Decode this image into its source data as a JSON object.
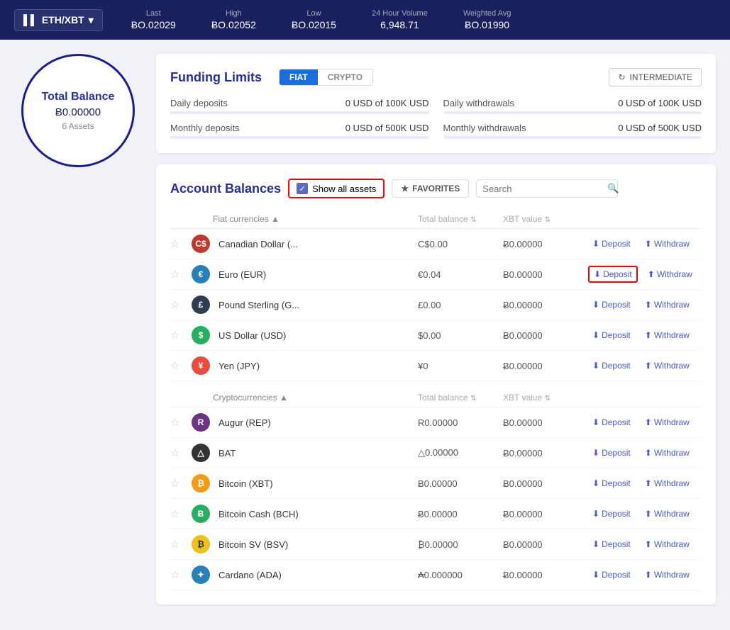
{
  "topbar": {
    "ticker": "ETH/XBT",
    "stats": [
      {
        "label": "Last",
        "value": "ɃO.02029"
      },
      {
        "label": "High",
        "value": "ɃO.02052"
      },
      {
        "label": "Low",
        "value": "ɃO.02015"
      },
      {
        "label": "24 Hour Volume",
        "value": "6,948.71"
      },
      {
        "label": "Weighted Avg",
        "value": "ɃO.01990"
      }
    ]
  },
  "balance": {
    "title": "Total Balance",
    "amount": "Ƀ0.00000",
    "assets": "6 Assets"
  },
  "funding": {
    "title": "Funding Limits",
    "tab_fiat": "FIAT",
    "tab_crypto": "CRYPTO",
    "level_btn": "INTERMEDIATE",
    "rows": [
      {
        "label": "Daily deposits",
        "value": "0 USD of 100K USD"
      },
      {
        "label": "Daily withdrawals",
        "value": "0 USD of 100K USD"
      },
      {
        "label": "Monthly deposits",
        "value": "0 USD of 500K USD"
      },
      {
        "label": "Monthly withdrawals",
        "value": "0 USD of 500K USD"
      }
    ]
  },
  "balances": {
    "title": "Account Balances",
    "show_all_label": "Show all assets",
    "favorites_label": "FAVORITES",
    "search_placeholder": "Search",
    "fiat_section": "Fiat currencies ▲",
    "crypto_section": "Cryptocurrencies ▲",
    "col_total": "Total balance",
    "col_xbt": "XBT value",
    "fiat_assets": [
      {
        "name": "Canadian Dollar (...",
        "icon_class": "icon-cad",
        "icon_text": "C$",
        "total": "C$0.00",
        "xbt": "Ƀ0.00000",
        "deposit_highlighted": false
      },
      {
        "name": "Euro (EUR)",
        "icon_class": "icon-eur",
        "icon_text": "€",
        "total": "€0.04",
        "xbt": "Ƀ0.00000",
        "deposit_highlighted": true
      },
      {
        "name": "Pound Sterling (G...",
        "icon_class": "icon-gbp",
        "icon_text": "£",
        "total": "£0.00",
        "xbt": "Ƀ0.00000",
        "deposit_highlighted": false
      },
      {
        "name": "US Dollar (USD)",
        "icon_class": "icon-usd",
        "icon_text": "$",
        "total": "$0.00",
        "xbt": "Ƀ0.00000",
        "deposit_highlighted": false
      },
      {
        "name": "Yen (JPY)",
        "icon_class": "icon-jpy",
        "icon_text": "¥",
        "total": "¥0",
        "xbt": "Ƀ0.00000",
        "deposit_highlighted": false
      }
    ],
    "crypto_assets": [
      {
        "name": "Augur (REP)",
        "icon_class": "icon-rep",
        "icon_text": "R",
        "total": "R0.00000",
        "xbt": "Ƀ0.00000",
        "deposit_highlighted": false
      },
      {
        "name": "BAT",
        "icon_class": "icon-bat",
        "icon_text": "△",
        "total": "△0.00000",
        "xbt": "Ƀ0.00000",
        "deposit_highlighted": false
      },
      {
        "name": "Bitcoin (XBT)",
        "icon_class": "icon-btc",
        "icon_text": "₿",
        "total": "Ƀ0.00000",
        "xbt": "Ƀ0.00000",
        "deposit_highlighted": false
      },
      {
        "name": "Bitcoin Cash (BCH)",
        "icon_class": "icon-bch",
        "icon_text": "Ƀ",
        "total": "Ƀ0.00000",
        "xbt": "Ƀ0.00000",
        "deposit_highlighted": false
      },
      {
        "name": "Bitcoin SV (BSV)",
        "icon_class": "icon-bsv",
        "icon_text": "₿",
        "total": "₿0.00000",
        "xbt": "Ƀ0.00000",
        "deposit_highlighted": false
      },
      {
        "name": "Cardano (ADA)",
        "icon_class": "icon-ada",
        "icon_text": "✦",
        "total": "₳0.000000",
        "xbt": "Ƀ0.00000",
        "deposit_highlighted": false
      }
    ],
    "deposit_label": "Deposit",
    "withdraw_label": "Withdraw"
  }
}
